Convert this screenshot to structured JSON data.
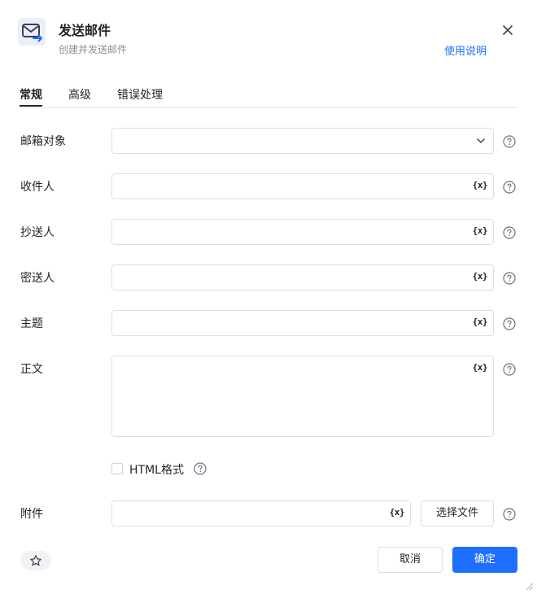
{
  "header": {
    "title": "发送邮件",
    "subtitle": "创建并发送邮件",
    "help_link": "使用说明",
    "icon": "mail-send-icon"
  },
  "tabs": [
    {
      "label": "常规",
      "active": true
    },
    {
      "label": "高级",
      "active": false
    },
    {
      "label": "错误处理",
      "active": false
    }
  ],
  "form": {
    "mailbox": {
      "label": "邮箱对象",
      "value": ""
    },
    "to": {
      "label": "收件人",
      "value": ""
    },
    "cc": {
      "label": "抄送人",
      "value": ""
    },
    "bcc": {
      "label": "密送人",
      "value": ""
    },
    "subject": {
      "label": "主题",
      "value": ""
    },
    "body": {
      "label": "正文",
      "value": ""
    },
    "html_format": {
      "label": "HTML格式",
      "checked": false
    },
    "attachment": {
      "label": "附件",
      "value": "",
      "button": "选择文件"
    }
  },
  "var_icon_text": "{x}",
  "footer": {
    "cancel": "取消",
    "ok": "确定"
  },
  "colors": {
    "accent": "#1e6fff",
    "border": "#dcdfe4",
    "text": "#1f2329",
    "muted": "#8a8f99"
  }
}
